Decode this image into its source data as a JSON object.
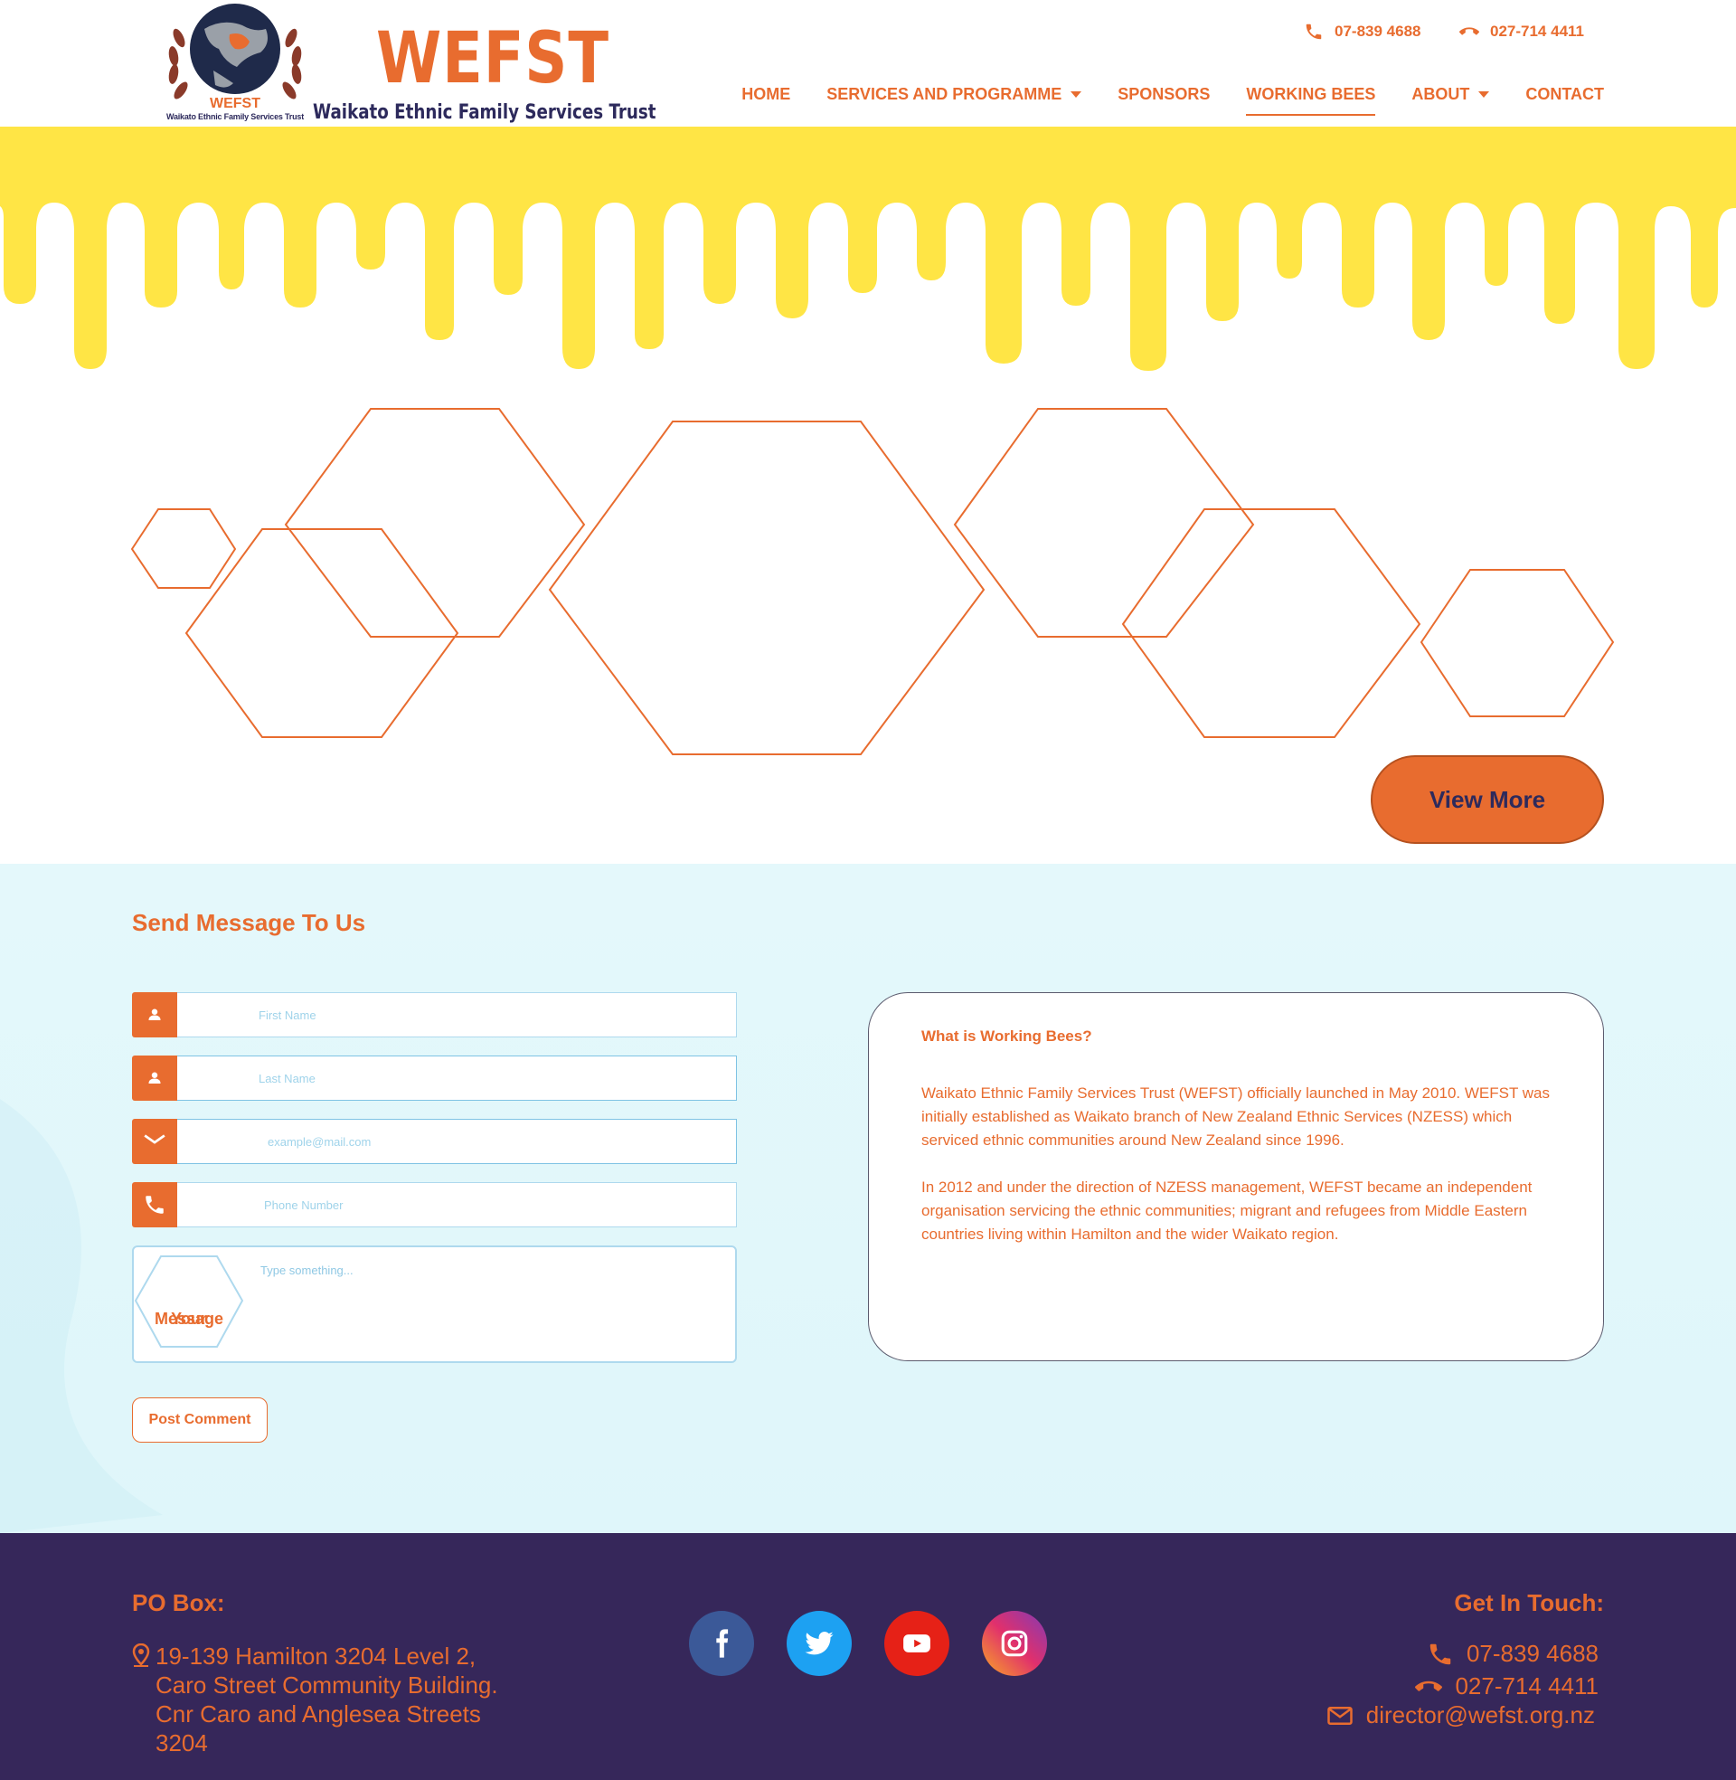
{
  "header": {
    "emblem_short": "WEFST",
    "emblem_caption": "Waikato Ethnic Family Services Trust",
    "brand_title": "WEFST",
    "brand_subtitle": "Waikato Ethnic Family Services Trust",
    "phone_1": "07-839 4688",
    "phone_2": "027-714 4411",
    "colors": {
      "accent": "#e86c2f",
      "navy": "#2d2a5c",
      "honey": "#ffe545"
    }
  },
  "nav": {
    "items": [
      {
        "label": "HOME"
      },
      {
        "label": "SERVICES AND PROGRAMME"
      },
      {
        "label": "SPONSORS"
      },
      {
        "label": "WORKING BEES"
      },
      {
        "label": "ABOUT"
      },
      {
        "label": "CONTACT"
      }
    ]
  },
  "hero": {
    "view_more_label": "View More"
  },
  "message_form": {
    "title": "Send Message To Us",
    "first_name_placeholder": "First Name",
    "last_name_placeholder": "Last Name",
    "email_placeholder": "example@mail.com",
    "phone_placeholder": "Phone Number",
    "message_label_line1": "Your",
    "message_label_line2": "Message",
    "message_placeholder": "Type something...",
    "post_label": "Post Comment"
  },
  "info_card": {
    "heading": "What is Working Bees?",
    "paragraph_1": "Waikato Ethnic Family Services Trust (WEFST) officially launched in May 2010. WEFST was initially established as Waikato branch of New Zealand Ethnic Services (NZESS) which serviced ethnic communities around New Zealand since 1996.",
    "paragraph_2": "In 2012 and under the direction of NZESS management, WEFST became an independent organisation servicing the ethnic communities; migrant and refugees from Middle Eastern countries living within Hamilton and the wider Waikato region."
  },
  "footer": {
    "po_box_heading": "PO Box:",
    "address": "19-139 Hamilton 3204 Level 2, Caro Street Community Building. Cnr Caro and Anglesea Streets 3204",
    "get_in_touch_heading": "Get In Touch:",
    "phone_1": "07-839 4688",
    "phone_2": "027-714 4411",
    "email": "director@wefst.org.nz",
    "socials": [
      {
        "name": "facebook-icon",
        "color": "#3b5998"
      },
      {
        "name": "twitter-icon",
        "color": "#1da1f2"
      },
      {
        "name": "youtube-icon",
        "color": "#e62117"
      },
      {
        "name": "instagram-icon",
        "color": "#c13584"
      }
    ]
  }
}
